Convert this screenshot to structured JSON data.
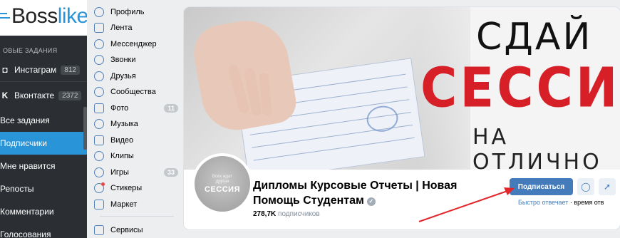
{
  "bosslike": {
    "logo_prefix": "Boss",
    "logo_suffix": "like",
    "section_title": "ОВЫЕ ЗАДАНИЯ",
    "networks": [
      {
        "label": "Инстаграм",
        "count": "812",
        "icon": "instagram-icon"
      },
      {
        "label": "Вконтакте",
        "count": "2372",
        "icon": "vk-icon"
      }
    ],
    "items": [
      {
        "label": "Все задания"
      },
      {
        "label": "Подписчики"
      },
      {
        "label": "Мне нравится"
      },
      {
        "label": "Репосты"
      },
      {
        "label": "Комментарии"
      },
      {
        "label": "Голосования"
      }
    ]
  },
  "vk_menu": {
    "items": [
      {
        "label": "Профиль",
        "icon": "profile-icon"
      },
      {
        "label": "Лента",
        "icon": "news-icon"
      },
      {
        "label": "Мессенджер",
        "icon": "messenger-icon"
      },
      {
        "label": "Звонки",
        "icon": "calls-icon"
      },
      {
        "label": "Друзья",
        "icon": "friends-icon"
      },
      {
        "label": "Сообщества",
        "icon": "communities-icon"
      },
      {
        "label": "Фото",
        "icon": "photo-icon",
        "badge": "11"
      },
      {
        "label": "Музыка",
        "icon": "music-icon"
      },
      {
        "label": "Видео",
        "icon": "video-icon"
      },
      {
        "label": "Клипы",
        "icon": "clips-icon"
      },
      {
        "label": "Игры",
        "icon": "games-icon",
        "badge": "33"
      },
      {
        "label": "Стикеры",
        "icon": "stickers-icon"
      },
      {
        "label": "Маркет",
        "icon": "market-icon"
      },
      {
        "label": "Сервисы",
        "icon": "services-icon"
      }
    ]
  },
  "group": {
    "cover": {
      "line1": "СДАЙ",
      "line2": "СЕССИ",
      "line3": "НА ОТЛИЧНО"
    },
    "avatar": {
      "small_text": "Всех ждет другая",
      "big_text": "СЕССИЯ"
    },
    "name": "Дипломы Курсовые Отчеты | Новая Помощь Студентам",
    "subscribers_count": "278,7K",
    "subscribers_label": "подписчиков",
    "subscribe_button": "Подписаться",
    "message_icon": "message-icon",
    "share_icon": "share-icon",
    "reply_status": "Быстро отвечает",
    "reply_time": "· время отв"
  },
  "colors": {
    "bosslike_sidebar": "#2b2f33",
    "bosslike_accent": "#2a94d8",
    "vk_blue": "#447bba",
    "cover_red": "#d61f27",
    "annotation_arrow": "#e3262b"
  }
}
